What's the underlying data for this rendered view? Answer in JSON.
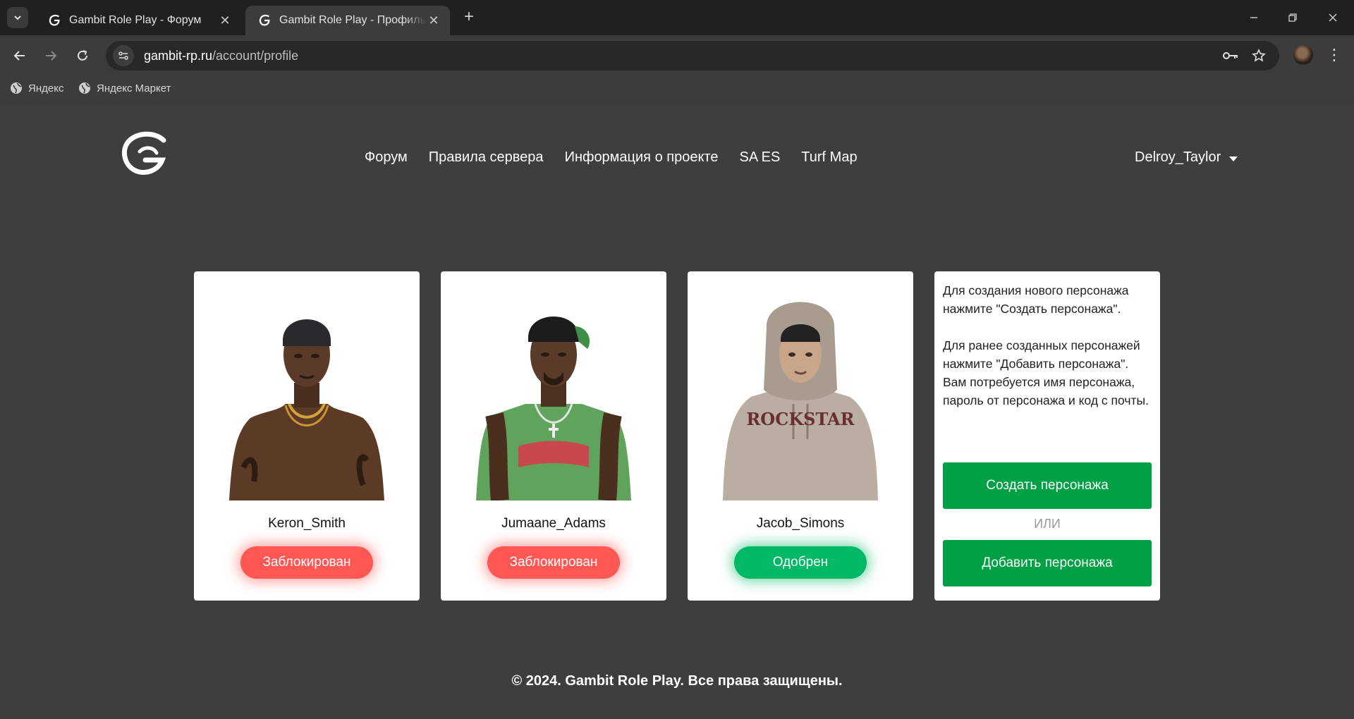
{
  "browser": {
    "tabs": [
      {
        "title": "Gambit Role Play - Форум",
        "active": false
      },
      {
        "title": "Gambit Role Play - Профиль UCP",
        "active": true
      }
    ],
    "new_tab_icon": "plus-icon",
    "url_host": "gambit-rp.ru",
    "url_path": "/account/profile",
    "bookmarks": [
      "Яндекс",
      "Яндекс Маркет"
    ]
  },
  "site": {
    "nav": [
      "Форум",
      "Правила сервера",
      "Информация о проекте",
      "SA ES",
      "Turf Map"
    ],
    "username": "Delroy_Taylor",
    "characters": [
      {
        "name": "Keron_Smith",
        "status": "Заблокирован",
        "status_type": "blocked"
      },
      {
        "name": "Jumaane_Adams",
        "status": "Заблокирован",
        "status_type": "blocked"
      },
      {
        "name": "Jacob_Simons",
        "status": "Одобрен",
        "status_type": "approved"
      }
    ],
    "info": {
      "paragraph1": "Для создания нового персонажа нажмите \"Создать персонажа\".",
      "paragraph2": "Для ранее созданных персонажей нажмите \"Добавить персонажа\". Вам потребуется имя персонажа, пароль от персонажа и код с почты.",
      "create_button": "Создать персонажа",
      "or_label": "ИЛИ",
      "add_button": "Добавить персонажа"
    },
    "footer": "© 2024. Gambit Role Play. Все права защищены.",
    "colors": {
      "blocked": "#ff5753",
      "approved": "#00b865",
      "action": "#00a044",
      "background": "#3d3e40"
    }
  }
}
